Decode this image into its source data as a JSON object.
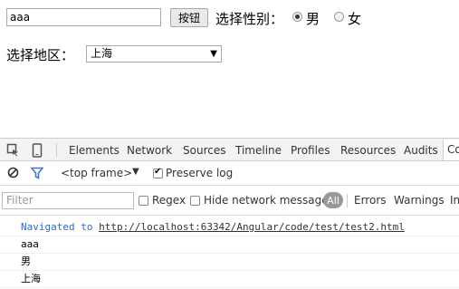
{
  "form": {
    "text_value": "aaa",
    "button_label": "按钮",
    "gender_label": "选择性别：",
    "gender_options": [
      {
        "label": "男",
        "checked": true
      },
      {
        "label": "女",
        "checked": false
      }
    ],
    "region_label": "选择地区：",
    "region_selected": "上海"
  },
  "devtools": {
    "tabs": [
      "Elements",
      "Network",
      "Sources",
      "Timeline",
      "Profiles",
      "Resources",
      "Audits",
      "Co"
    ],
    "icons": [
      "inspect-icon",
      "device-icon"
    ],
    "frame_select": "<top frame>",
    "preserve_log": {
      "label": "Preserve log",
      "checked": true
    },
    "filter_placeholder": "Filter",
    "regex": {
      "label": "Regex",
      "checked": false
    },
    "hide_network": {
      "label": "Hide network messages",
      "checked": false
    },
    "levels": [
      "All",
      "Errors",
      "Warnings",
      "In"
    ],
    "console": {
      "navigated_prefix": "Navigated to",
      "navigated_url": "http://localhost:63342/Angular/code/test/test2.html",
      "logs": [
        "aaa",
        "男",
        "上海"
      ]
    }
  }
}
